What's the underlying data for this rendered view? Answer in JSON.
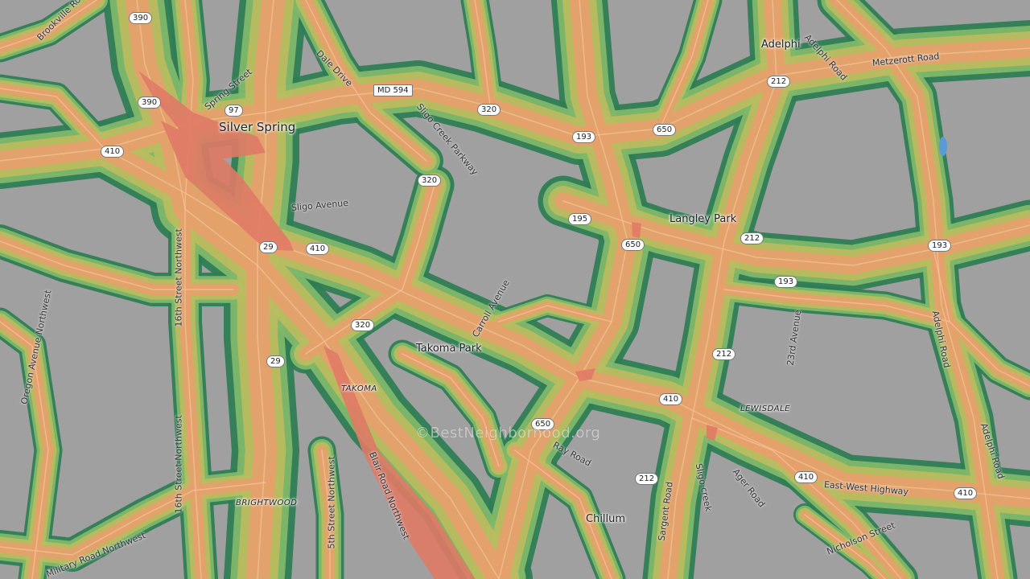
{
  "places": {
    "silver_spring": "Silver Spring",
    "adelphi": "Adelphi",
    "langley_park": "Langley Park",
    "takoma_park": "Takoma Park",
    "chillum": "Chillum",
    "takoma": "TAKOMA",
    "lewisdale": "LEWISDALE",
    "brightwood": "BRIGHTWOOD"
  },
  "streets": {
    "brookville": "Brookville Ro",
    "spring": "Spring Street",
    "dale": "Dale Drive",
    "sligo_pkwy": "Sligo Creek Parkway",
    "sligo_ave": "Sligo Avenue",
    "carroll": "Carroll Avenue",
    "sixteenth_1": "16th Street Northwest",
    "sixteenth_2": "16th Street Northwest",
    "oregon": "Oregon Avenue Northwest",
    "military": "Military Road Northwest",
    "fifth": "5th Street Northwest",
    "blair": "Blair Road Northwest",
    "adelphi_rd_1": "Adelphi Road",
    "adelphi_rd_2": "Adelphi Road",
    "adelphi_rd_3": "Adelphi Road",
    "metzerott": "Metzerott Road",
    "twenty_third": "23rd Avenue",
    "ager": "Ager Road",
    "sligo_creek": "Sligo creek",
    "east_west": "East-West Highway",
    "nicholson": "Nicholson Street",
    "sargent": "Sargent Road",
    "ray": "Ray Road"
  },
  "shields": {
    "s390a": "390",
    "s390b": "390",
    "s97": "97",
    "s410a": "410",
    "smd594": "MD 594",
    "s320a": "320",
    "s320b": "320",
    "s193a": "193",
    "s650a": "650",
    "s212a": "212",
    "s195": "195",
    "s650b": "650",
    "s29a": "29",
    "s410b": "410",
    "s212b": "212",
    "s193b": "193",
    "s193c": "193",
    "s320c": "320",
    "s29b": "29",
    "s212c": "212",
    "s410c": "410",
    "s650c": "650",
    "s212d": "212",
    "s410d": "410",
    "s410e": "410"
  },
  "watermark": "©BestNeighborhood.org",
  "colors": {
    "block": "#a3a3a3",
    "outer_green": "#2f7d55",
    "mid_green": "#7fb86a",
    "yellow_green": "#b9bc60",
    "orange": "#e6a06b",
    "red": "#e07a66"
  }
}
